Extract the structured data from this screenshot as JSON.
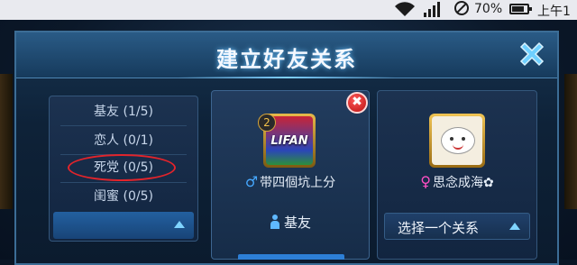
{
  "status_bar": {
    "battery_text": "70%",
    "time_text": "上午1"
  },
  "dialog": {
    "title": "建立好友关系"
  },
  "relations": {
    "items": [
      {
        "label": "基友 (1/5)"
      },
      {
        "label": "恋人 (0/1)"
      },
      {
        "label": "死党 (0/5)"
      },
      {
        "label": "闺蜜 (0/5)"
      }
    ],
    "highlighted_index": 2,
    "highlight_color": "#e2242b"
  },
  "friend_card": {
    "level": "2",
    "avatar_text": "LIFAN",
    "gender_symbol": "♂",
    "name": "带四個坑上分",
    "relation": "基友"
  },
  "target_card": {
    "gender_symbol": "♀",
    "name": "思念成海✿",
    "select_label": "选择一个关系"
  },
  "colors": {
    "accent": "#2d7fd6",
    "male": "#46a8ff",
    "female": "#ff4fc4",
    "close": "#6fd0ff",
    "remove": "#d61d1d"
  }
}
